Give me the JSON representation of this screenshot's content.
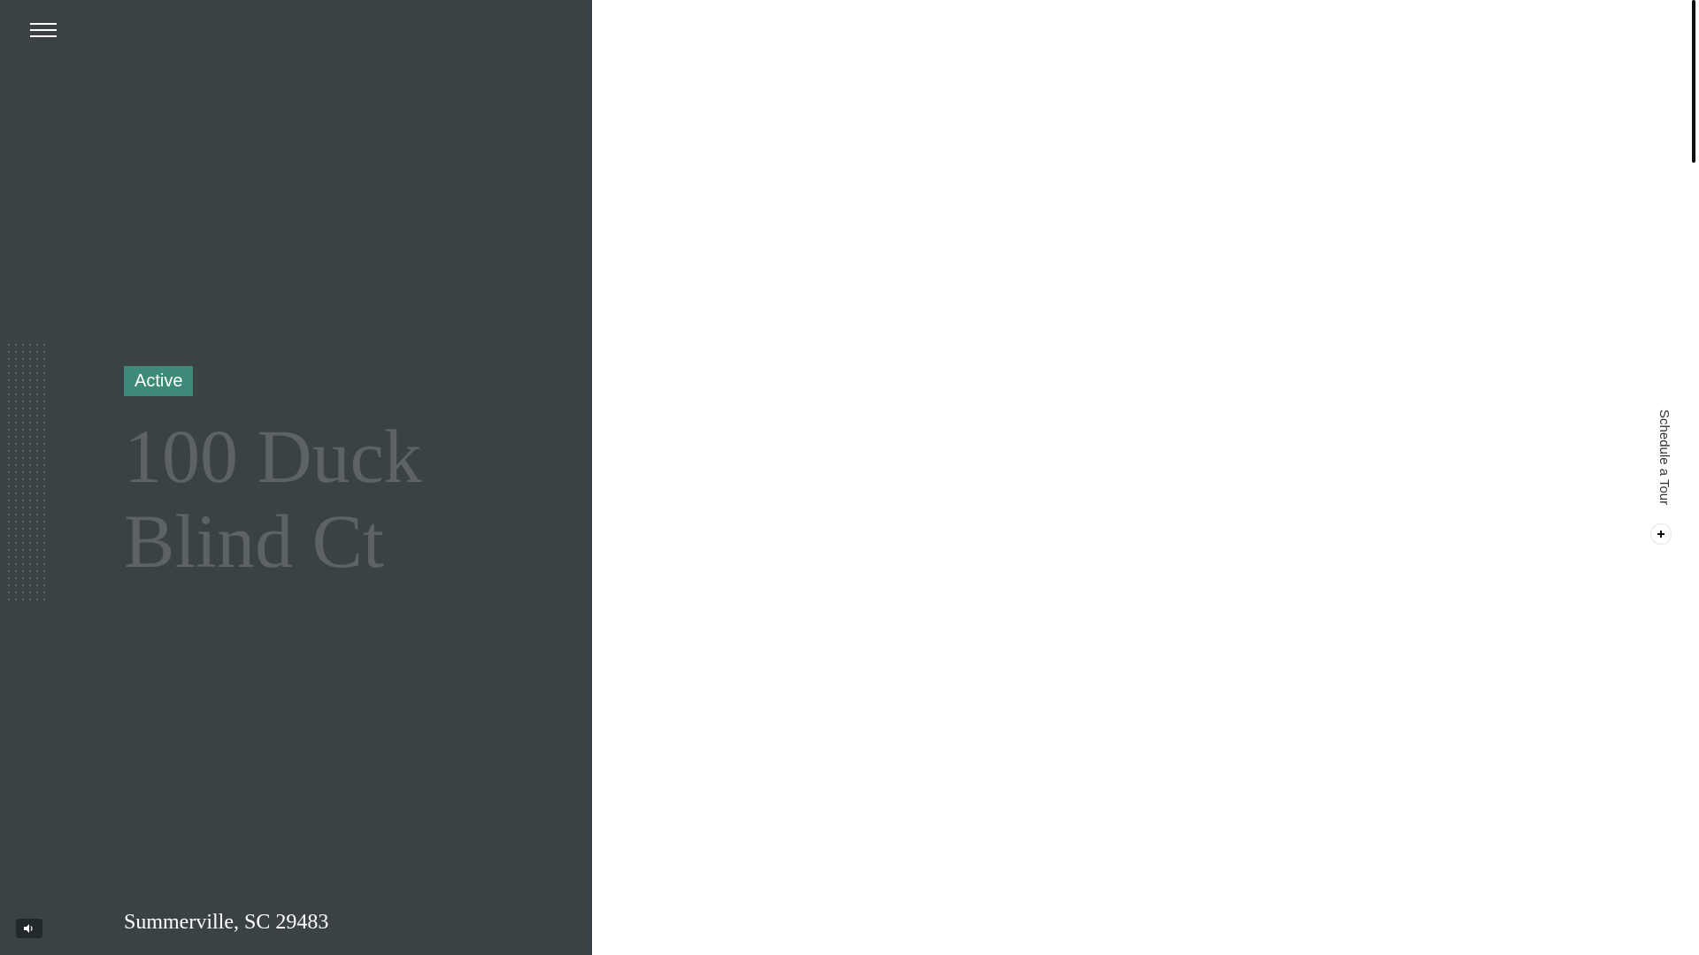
{
  "listing": {
    "status": "Active",
    "address_line_1": "100 Duck",
    "address_line_2": "Blind Ct",
    "city_state_zip": "Summerville, SC 29483"
  },
  "actions": {
    "schedule_tour_label": "Schedule a Tour"
  },
  "icons": {
    "menu": "hamburger-menu-icon",
    "sound": "speaker-icon",
    "schedule": "plus-icon"
  },
  "colors": {
    "panel_background": "#3a4245",
    "status_badge": "#3d8a78",
    "title_text": "#5d6365",
    "page_background": "#ffffff"
  }
}
